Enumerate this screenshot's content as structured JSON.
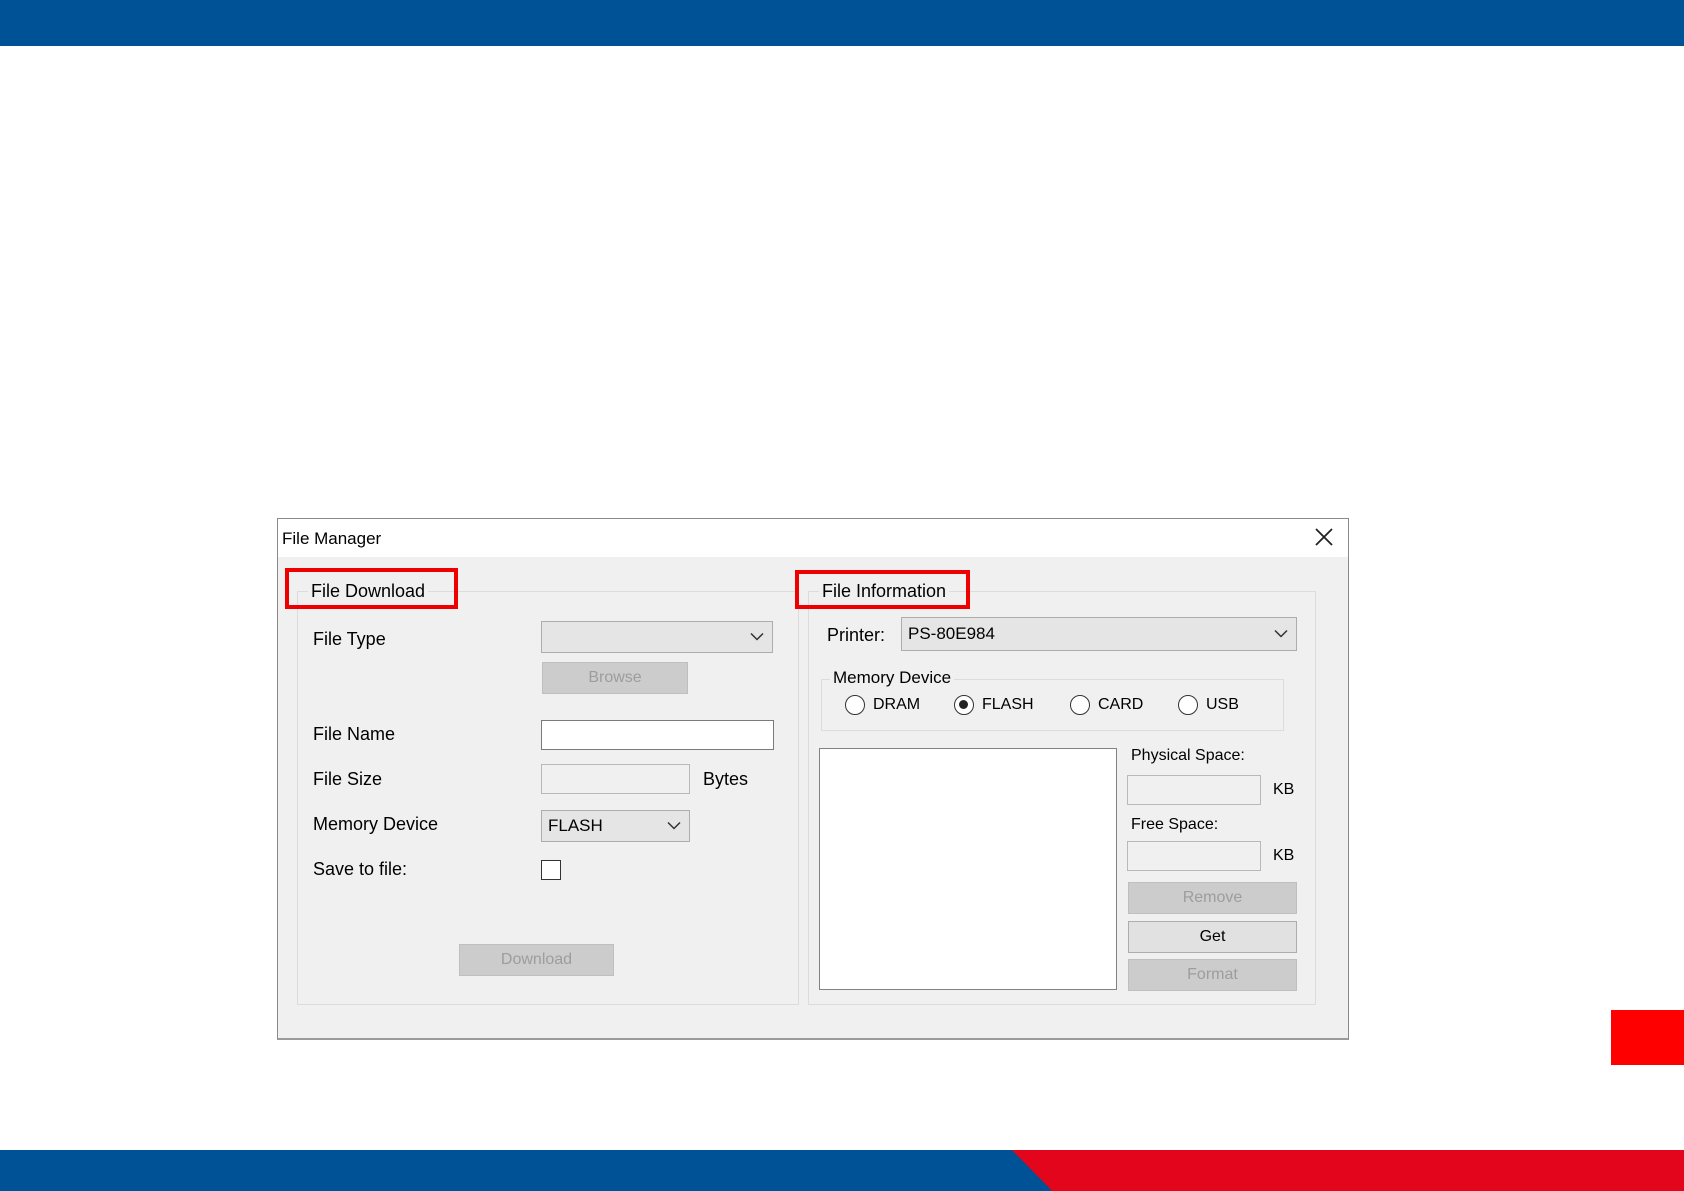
{
  "dialog": {
    "title": "File Manager",
    "file_download": {
      "legend": "File Download",
      "file_type_label": "File Type",
      "file_type_value": "",
      "browse_label": "Browse",
      "file_name_label": "File Name",
      "file_name_value": "",
      "file_size_label": "File Size",
      "file_size_value": "",
      "bytes_label": "Bytes",
      "memory_device_label": "Memory Device",
      "memory_device_value": "FLASH",
      "save_to_file_label": "Save to file:",
      "save_to_file_checked": false,
      "download_label": "Download"
    },
    "file_information": {
      "legend": "File Information",
      "printer_label": "Printer:",
      "printer_value": "PS-80E984",
      "memory_device_legend": "Memory Device",
      "radios": [
        {
          "label": "DRAM",
          "selected": false
        },
        {
          "label": "FLASH",
          "selected": true
        },
        {
          "label": "CARD",
          "selected": false
        },
        {
          "label": "USB",
          "selected": false
        }
      ],
      "physical_space_label": "Physical Space:",
      "physical_space_value": "",
      "physical_unit": "KB",
      "free_space_label": "Free Space:",
      "free_space_value": "",
      "free_unit": "KB",
      "remove_label": "Remove",
      "get_label": "Get",
      "format_label": "Format"
    }
  },
  "colors": {
    "brand_blue": "#005296",
    "brand_red": "#e3051b",
    "highlight_red": "#ee0000"
  }
}
